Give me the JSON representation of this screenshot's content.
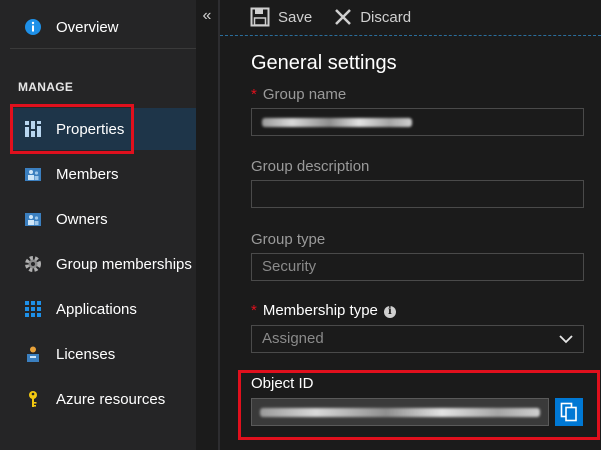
{
  "sidebar": {
    "overview": {
      "label": "Overview",
      "icon": "info-icon"
    },
    "section_heading": "MANAGE",
    "items": [
      {
        "label": "Properties",
        "icon": "properties-icon",
        "active": true
      },
      {
        "label": "Members",
        "icon": "members-icon"
      },
      {
        "label": "Owners",
        "icon": "owners-icon"
      },
      {
        "label": "Group memberships",
        "icon": "gear-icon"
      },
      {
        "label": "Applications",
        "icon": "applications-grid-icon"
      },
      {
        "label": "Licenses",
        "icon": "licenses-icon"
      },
      {
        "label": "Azure resources",
        "icon": "key-icon"
      }
    ],
    "collapse_glyph": "«"
  },
  "toolbar": {
    "save_label": "Save",
    "discard_label": "Discard"
  },
  "main": {
    "section_title": "General settings",
    "group_name": {
      "label": "Group name",
      "required": true
    },
    "group_description": {
      "label": "Group description",
      "value": ""
    },
    "group_type": {
      "label": "Group type",
      "value": "Security"
    },
    "membership_type": {
      "label": "Membership type",
      "required": true,
      "value": "Assigned"
    },
    "object_id": {
      "label": "Object ID"
    }
  },
  "colors": {
    "accent": "#0078d4",
    "highlight": "#e0101d",
    "required": "#e0101d",
    "active_bg": "#1e3549"
  }
}
